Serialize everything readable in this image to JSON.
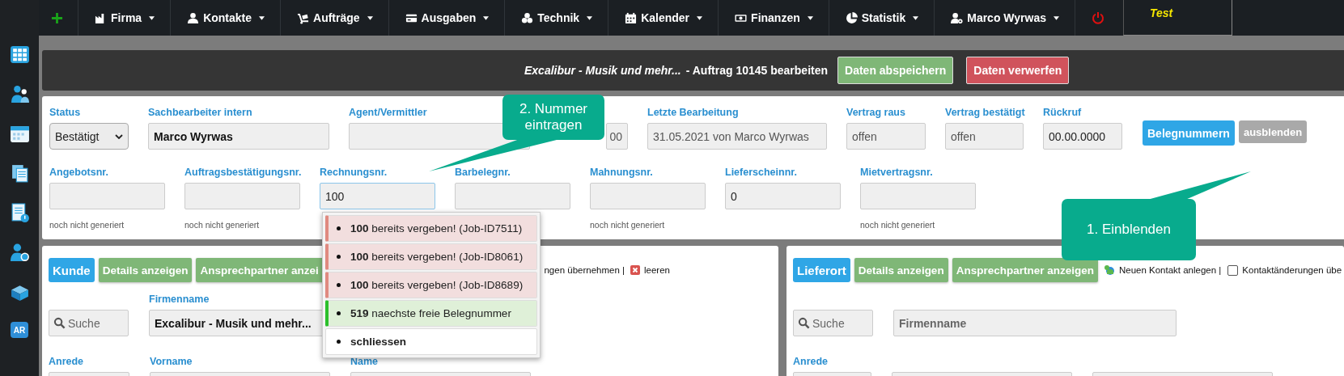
{
  "sidebar": {
    "app_badge": "AR"
  },
  "nav": {
    "items": [
      {
        "label": "Firma"
      },
      {
        "label": "Kontakte"
      },
      {
        "label": "Aufträge"
      },
      {
        "label": "Ausgaben"
      },
      {
        "label": "Technik"
      },
      {
        "label": "Kalender"
      },
      {
        "label": "Finanzen"
      },
      {
        "label": "Statistik"
      },
      {
        "label": "Marco Wyrwas"
      }
    ],
    "environment": "Test"
  },
  "title_bar": {
    "company": "Excalibur - Musik und mehr...",
    "text": "- Auftrag 10145 bearbeiten",
    "buttons": [
      {
        "label": "Daten abspeichern",
        "kind": "save"
      },
      {
        "label": "Daten verwerfen",
        "kind": "discard"
      }
    ]
  },
  "form": {
    "row_1": [
      {
        "label": "Status",
        "value": "Bestätigt",
        "kind": "select"
      },
      {
        "label": "Sachbearbeiter intern",
        "value": "Marco Wyrwas",
        "kind": "strong"
      },
      {
        "label": "Agent/Vermittler",
        "kind": "input"
      },
      {
        "value": "00",
        "kind": "covered"
      },
      {
        "label": "Letzte Bearbeitung",
        "value": "31.05.2021 von Marco Wyrwas",
        "kind": "input"
      },
      {
        "label": "Vertrag raus",
        "value": "offen",
        "kind": "input"
      },
      {
        "label": "Vertrag bestätigt",
        "value": "offen",
        "kind": "input"
      },
      {
        "label": "Rückruf",
        "value": "00.00.0000",
        "kind": "date"
      }
    ],
    "doc_number_buttons": [
      {
        "label": "Belegnummern",
        "disabled": false
      },
      {
        "label": "ausblenden",
        "disabled": true
      }
    ],
    "row_2": [
      {
        "label": "Angebotsnr.",
        "hint": "noch nicht generiert",
        "focused": false
      },
      {
        "label": "Auftragsbestätigungsnr.",
        "hint": "noch nicht generiert",
        "focused": false
      },
      {
        "label": "Rechnungsnr.",
        "value": "100",
        "focused": true
      },
      {
        "label": "Barbelegnr.",
        "focused": false
      },
      {
        "label": "Mahnungsnr.",
        "hint": "noch nicht generiert",
        "focused": false
      },
      {
        "label": "Lieferscheinnr.",
        "value": "0",
        "focused": false
      },
      {
        "label": "Mietvertragsnr.",
        "hint": "noch nicht generiert",
        "focused": false
      }
    ]
  },
  "suggestions": [
    {
      "text": "**100** bereits vergeben! (Job-ID7511)",
      "kind": "taken"
    },
    {
      "text": "**100** bereits vergeben! (Job-ID8061)",
      "kind": "taken"
    },
    {
      "text": "**100** bereits vergeben! (Job-ID8689)",
      "kind": "taken"
    },
    {
      "text": "**519** naechste freie Belegnummer",
      "kind": "free"
    },
    {
      "text": "schliessen",
      "kind": "close"
    }
  ],
  "customer_panel": {
    "title": "Kunde",
    "buttons": [
      "Details anzeigen",
      "Ansprechpartner anzei"
    ],
    "apply_text": "ngen übernehmen |",
    "clear_label": "leeren",
    "search_placeholder": "Suche",
    "company_label": "Firmenname",
    "company_value": "Excalibur - Musik und mehr...",
    "labels": [
      "Anrede",
      "Vorname",
      "Name"
    ]
  },
  "delivery_panel": {
    "title": "Lieferort",
    "buttons": [
      "Details anzeigen",
      "Ansprechpartner anzeigen"
    ],
    "new_contact": "Neuen Kontakt anlegen |",
    "checkbox": {
      "label": "Kontaktänderungen übe",
      "checked": false
    },
    "search_placeholder": "Suche",
    "company_placeholder": "Firmenname",
    "labels": [
      "Anrede"
    ]
  },
  "callouts": [
    {
      "text": "2. Nummer eintragen"
    },
    {
      "text": "1. Einblenden"
    }
  ]
}
